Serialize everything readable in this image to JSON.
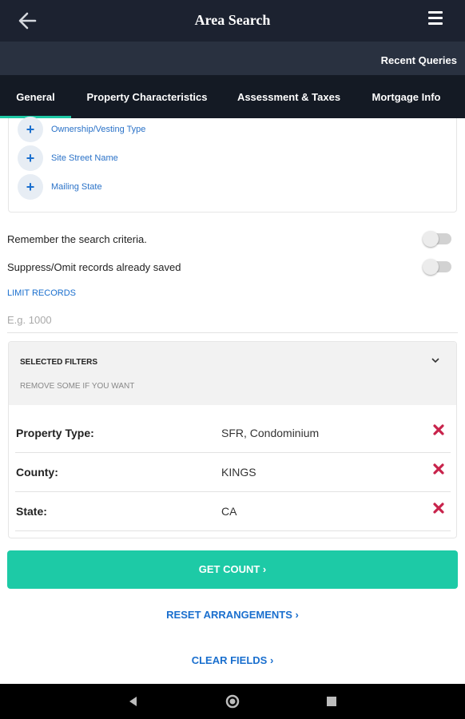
{
  "header": {
    "title": "Area Search",
    "recent_queries": "Recent Queries"
  },
  "tabs": [
    {
      "label": "General",
      "active": true
    },
    {
      "label": "Property Characteristics",
      "active": false
    },
    {
      "label": "Assessment & Taxes",
      "active": false
    },
    {
      "label": "Mortgage Info",
      "active": false
    }
  ],
  "add_fields": [
    {
      "label": "Ownership/Vesting Type",
      "icon": "plus-icon"
    },
    {
      "label": "Site Street Name",
      "icon": "plus-icon"
    },
    {
      "label": "Mailing State",
      "icon": "plus-icon"
    }
  ],
  "options": {
    "remember_label": "Remember the search criteria.",
    "remember_on": false,
    "suppress_label": "Suppress/Omit records already saved",
    "suppress_on": false
  },
  "limit": {
    "label": "LIMIT RECORDS",
    "placeholder": "E.g. 1000",
    "value": ""
  },
  "selected_filters": {
    "title": "SELECTED FILTERS",
    "subtitle": "REMOVE SOME IF YOU WANT",
    "rows": [
      {
        "label": "Property Type:",
        "value": "SFR, Condominium"
      },
      {
        "label": "County:",
        "value": "KINGS"
      },
      {
        "label": "State:",
        "value": "CA"
      }
    ]
  },
  "actions": {
    "get_count": "GET COUNT ›",
    "reset": "RESET ARRANGEMENTS ›",
    "clear": "CLEAR FIELDS ›"
  },
  "colors": {
    "app_bar": "#1c2230",
    "accent": "#1dcaa6",
    "link": "#1a6fce",
    "remove": "#c8234b"
  }
}
